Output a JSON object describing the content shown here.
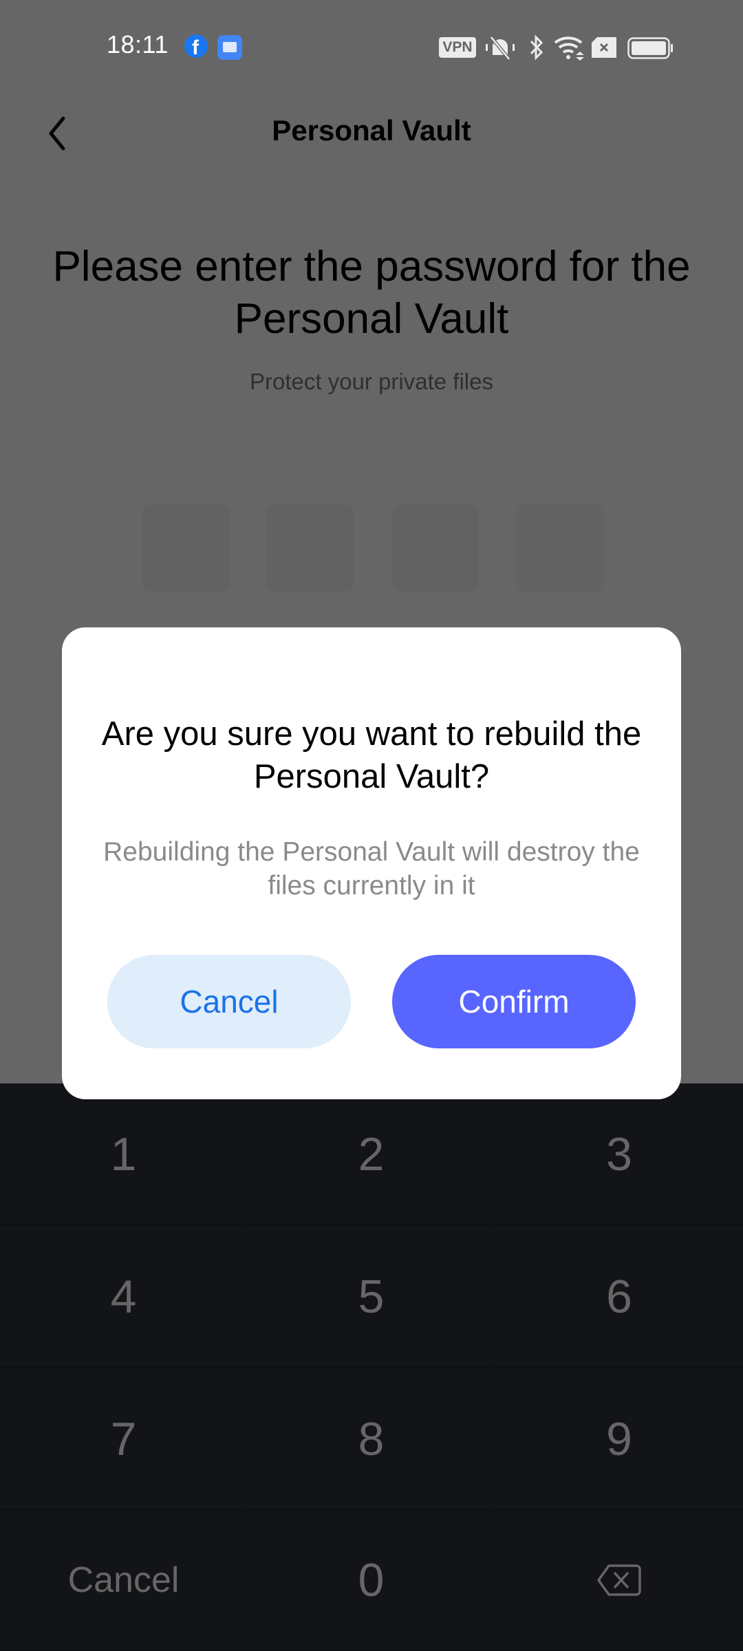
{
  "status_bar": {
    "time": "18:11",
    "notification_icons": [
      "facebook-icon",
      "mail-icon"
    ],
    "system_icons": [
      "vpn-icon",
      "silent-mode-icon",
      "bluetooth-icon",
      "wifi-icon",
      "no-sim-icon",
      "battery-icon"
    ],
    "vpn_label": "VPN"
  },
  "header": {
    "back_icon": "chevron-left-icon",
    "title": "Personal Vault"
  },
  "prompt": {
    "title": "Please enter the password for the Personal Vault",
    "subtitle": "Protect your private files",
    "pin_length": 4,
    "pin_entered": 0
  },
  "dialog": {
    "title": "Are you sure you want to rebuild the Personal Vault?",
    "message": "Rebuilding the Personal Vault will destroy the files currently in it",
    "cancel_label": "Cancel",
    "confirm_label": "Confirm",
    "colors": {
      "confirm_bg": "#5865ff",
      "cancel_bg": "#e0edfb",
      "cancel_text": "#1a73e8"
    }
  },
  "keypad": {
    "keys": [
      "1",
      "2",
      "3",
      "4",
      "5",
      "6",
      "7",
      "8",
      "9"
    ],
    "cancel_label": "Cancel",
    "zero": "0",
    "delete_icon": "backspace-icon"
  }
}
